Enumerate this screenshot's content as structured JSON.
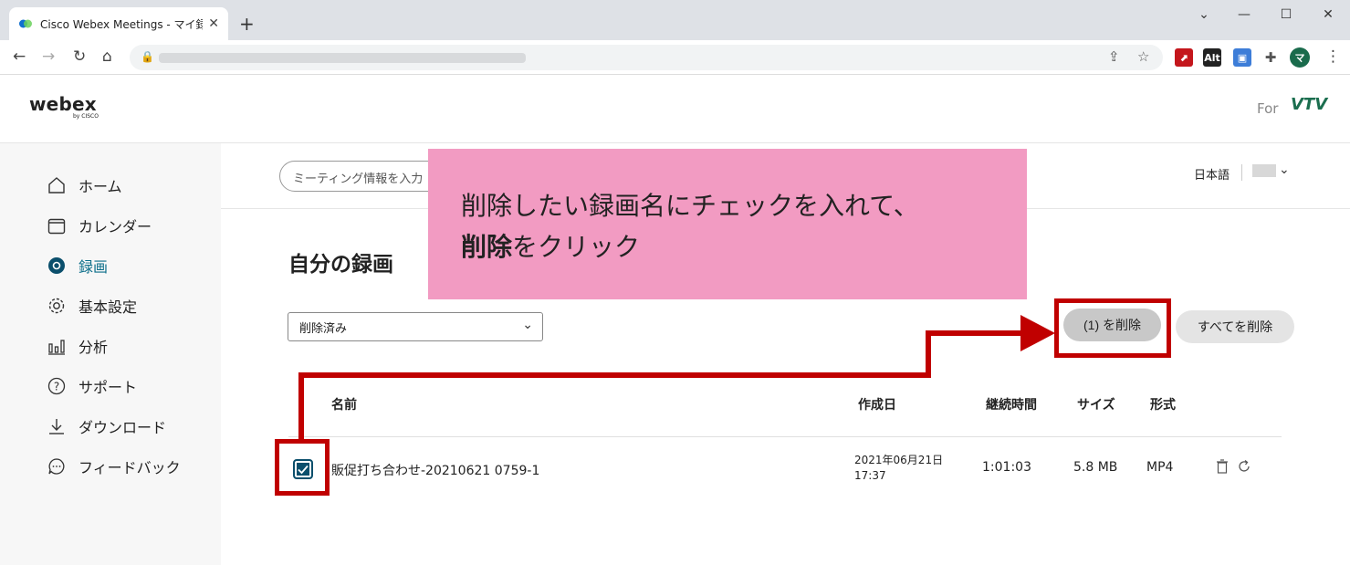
{
  "browser": {
    "tab_title": "Cisco Webex Meetings - マイ録画",
    "tab_close": "✕",
    "new_tab": "+",
    "ext_alt": "Alt",
    "profile_initial": "マ"
  },
  "header": {
    "logo_word": "webex",
    "logo_by": "by CISCO",
    "for_label": "For",
    "brand": "VTV"
  },
  "sidebar": {
    "items": [
      {
        "label": "ホーム",
        "icon": "home-icon"
      },
      {
        "label": "カレンダー",
        "icon": "calendar-icon"
      },
      {
        "label": "録画",
        "icon": "record-icon",
        "active": true
      },
      {
        "label": "基本設定",
        "icon": "gear-icon"
      },
      {
        "label": "分析",
        "icon": "chart-icon"
      },
      {
        "label": "サポート",
        "icon": "help-icon"
      },
      {
        "label": "ダウンロード",
        "icon": "download-icon"
      },
      {
        "label": "フィードバック",
        "icon": "feedback-icon"
      }
    ]
  },
  "topbar": {
    "search_placeholder": "ミーティング情報を入力",
    "language": "日本語"
  },
  "main": {
    "title": "自分の録画",
    "filter_value": "削除済み",
    "delete_button": "(1) を削除",
    "delete_all_button": "すべてを削除",
    "columns": [
      "名前",
      "作成日",
      "継続時間",
      "サイズ",
      "形式"
    ],
    "rows": [
      {
        "name": "販促打ち合わせ-20210621 0759-1",
        "created_date": "2021年06月21日",
        "created_time": "17:37",
        "duration": "1:01:03",
        "size": "5.8 MB",
        "format": "MP4",
        "checked": true
      }
    ]
  },
  "annotation": {
    "line1": "削除したい録画名にチェックを入れて、",
    "line2_bold": "削除",
    "line2_rest": "をクリック"
  },
  "colors": {
    "accent": "#0b6e8a",
    "annotation_bg": "#f29bc2",
    "annotation_red": "#c00000"
  }
}
